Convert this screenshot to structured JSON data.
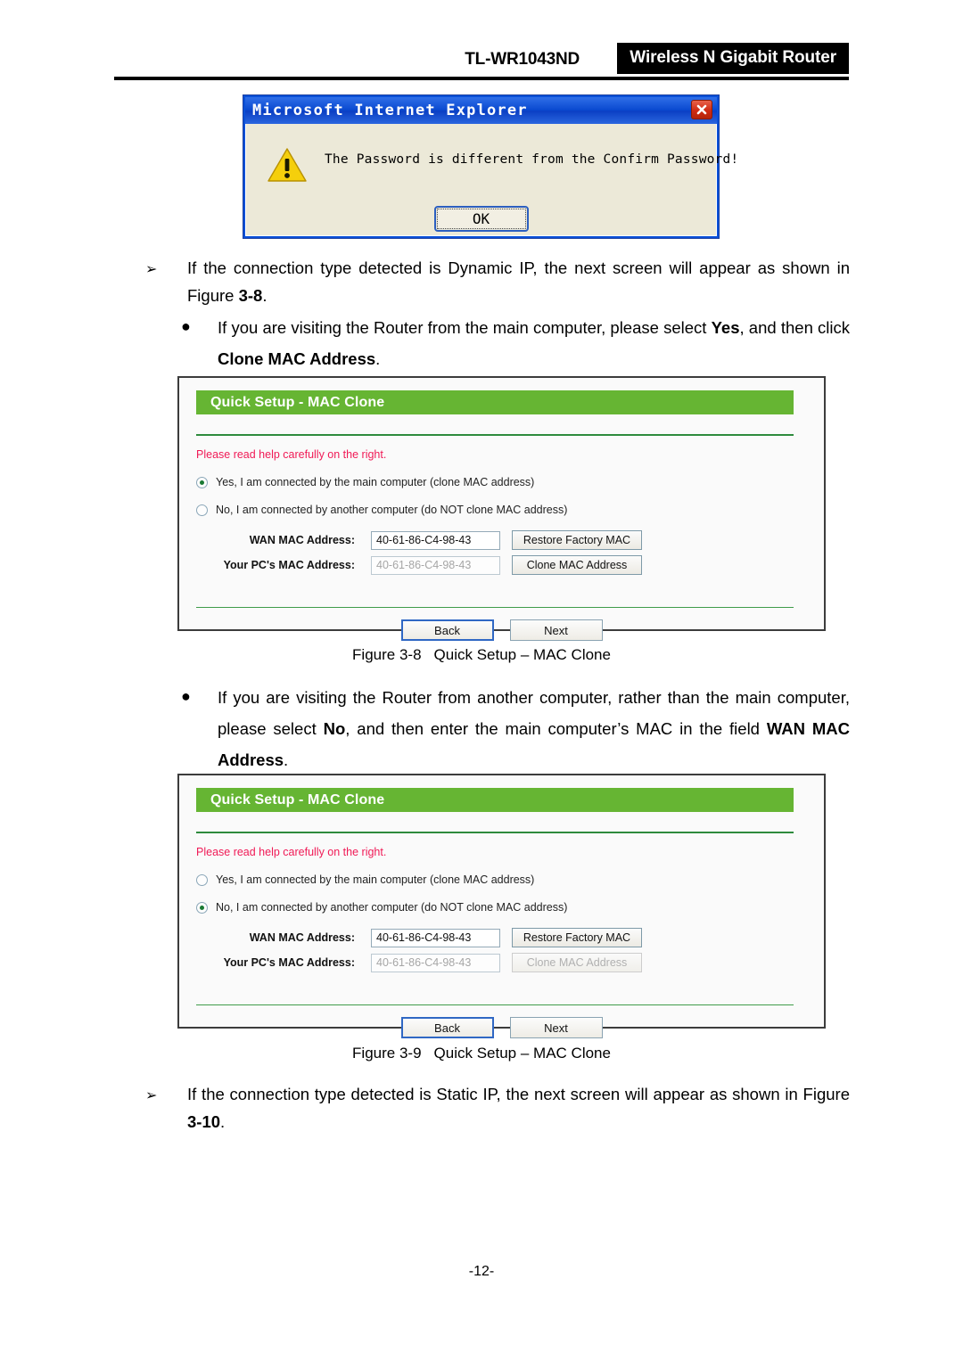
{
  "header": {
    "model": "TL-WR1043ND",
    "badge": "Wireless N Gigabit Router"
  },
  "dialog": {
    "title": "Microsoft Internet Explorer",
    "message": "The Password is different from the Confirm Password!",
    "ok_label": "OK",
    "close_icon": "close-icon",
    "warning_icon": "warning-triangle-icon"
  },
  "body": {
    "arrow_bullet_1": {
      "marker": "➢",
      "text_before": "If the connection type detected is Dynamic IP, the next screen will appear as shown in Figure ",
      "bold_part": "3-8",
      "text_after": "."
    },
    "dot_bullet_1": {
      "marker": "●",
      "seg1": "If you are visiting the Router from the main computer, please select ",
      "bold1": "Yes",
      "seg2": ", and then click ",
      "bold2": "Clone MAC Address",
      "seg3": "."
    },
    "dot_bullet_2": {
      "marker": "●",
      "seg1": "If you are visiting the Router from another computer, rather than the main computer, please select ",
      "bold1": "No",
      "seg2": ", and then enter the main computer’s MAC in the field ",
      "bold2": "WAN MAC Address",
      "seg3": "."
    },
    "arrow_bullet_2": {
      "marker": "➢",
      "text_before": "If the connection type detected is Static IP, the next screen will appear as shown in Figure ",
      "bold_part": "3-10",
      "text_after": "."
    }
  },
  "figure_8": {
    "number": "Figure 3-8",
    "caption": "Quick Setup – MAC Clone"
  },
  "figure_9": {
    "number": "Figure 3-9",
    "caption": "Quick Setup – MAC Clone"
  },
  "panel_1": {
    "title": "Quick Setup - MAC Clone",
    "help_text": "Please read help carefully on the right.",
    "radio_yes": {
      "label": "Yes, I am connected by the main computer (clone MAC address)",
      "checked": true
    },
    "radio_no": {
      "label": "No, I am connected by another computer (do NOT clone MAC address)",
      "checked": false
    },
    "wan_label": "WAN MAC Address:",
    "wan_value": "40-61-86-C4-98-43",
    "pc_label": "Your PC's MAC Address:",
    "pc_value": "40-61-86-C4-98-43",
    "restore_btn": "Restore Factory MAC",
    "clone_btn": "Clone MAC Address",
    "clone_btn_disabled": false,
    "back_btn": "Back",
    "next_btn": "Next"
  },
  "panel_2": {
    "title": "Quick Setup - MAC Clone",
    "help_text": "Please read help carefully on the right.",
    "radio_yes": {
      "label": "Yes, I am connected by the main computer (clone MAC address)",
      "checked": false
    },
    "radio_no": {
      "label": "No, I am connected by another computer (do NOT clone MAC address)",
      "checked": true
    },
    "wan_label": "WAN MAC Address:",
    "wan_value": "40-61-86-C4-98-43",
    "pc_label": "Your PC's MAC Address:",
    "pc_value": "40-61-86-C4-98-43",
    "restore_btn": "Restore Factory MAC",
    "clone_btn": "Clone MAC Address",
    "clone_btn_disabled": true,
    "back_btn": "Back",
    "next_btn": "Next"
  },
  "footer": {
    "page_number": "-12-"
  },
  "colors": {
    "panel_green": "#66b533",
    "divider_green": "#2e8b3d",
    "help_red": "#f01a56",
    "dialog_blue": "#0a50d8",
    "close_red": "#cf2b14"
  }
}
